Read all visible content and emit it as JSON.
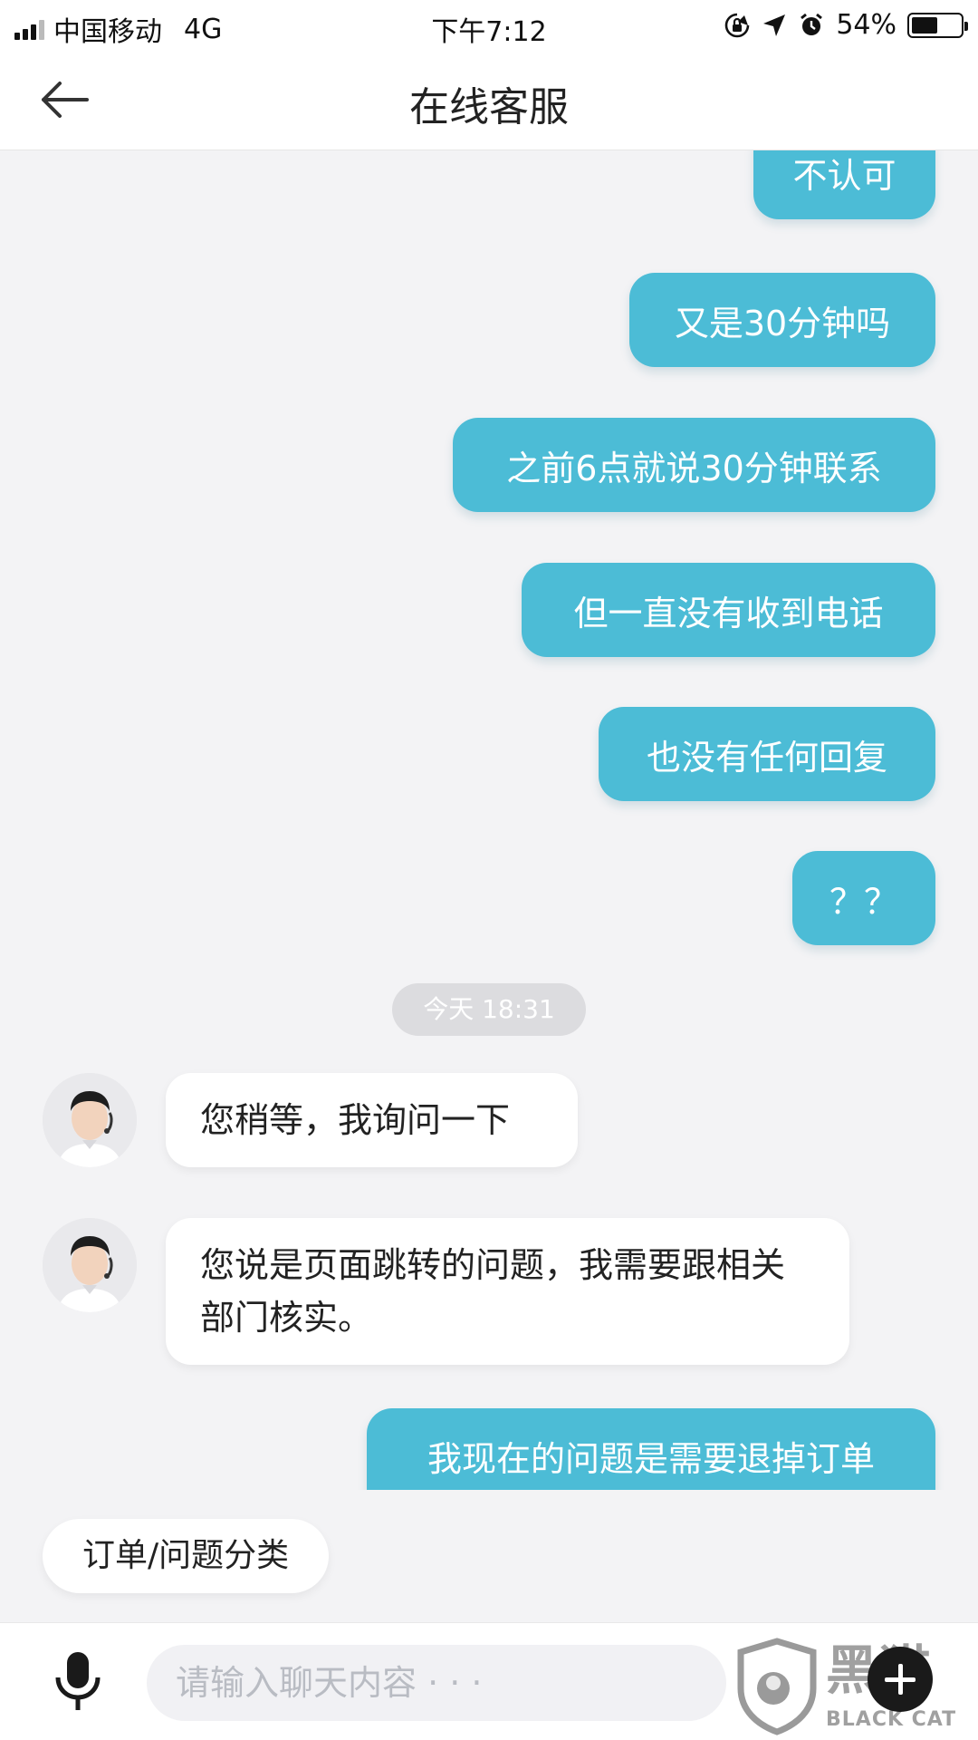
{
  "status_bar": {
    "carrier": "中国移动",
    "network": "4G",
    "time": "下午7:12",
    "battery_text": "54%",
    "icons": [
      "signal-icon",
      "orientation-lock-icon",
      "location-icon",
      "alarm-icon",
      "battery-icon"
    ]
  },
  "header": {
    "title": "在线客服",
    "back_icon": "arrow-left-icon"
  },
  "messages": {
    "m1": "不认可",
    "m2": "又是30分钟吗",
    "m3": "之前6点就说30分钟联系",
    "m4": "但一直没有收到电话",
    "m5": "也没有任何回复",
    "m6": "？？",
    "timestamp": "今天 18:31",
    "a1": "您稍等，我询问一下",
    "a2": "您说是页面跳转的问题，我需要跟相关部门核实。",
    "m7": "我现在的问题是需要退掉订单"
  },
  "quick_reply": {
    "label": "订单/问题分类"
  },
  "input_bar": {
    "placeholder": "请输入聊天内容 · · ·",
    "mic_icon": "microphone-icon",
    "plus_icon": "plus-icon",
    "watermark_text": "BLACK CAT",
    "watermark_logo_text": "黑猫"
  },
  "colors": {
    "outgoing_bubble": "#4cbcd6",
    "incoming_bubble": "#ffffff",
    "background": "#f3f3f5"
  }
}
